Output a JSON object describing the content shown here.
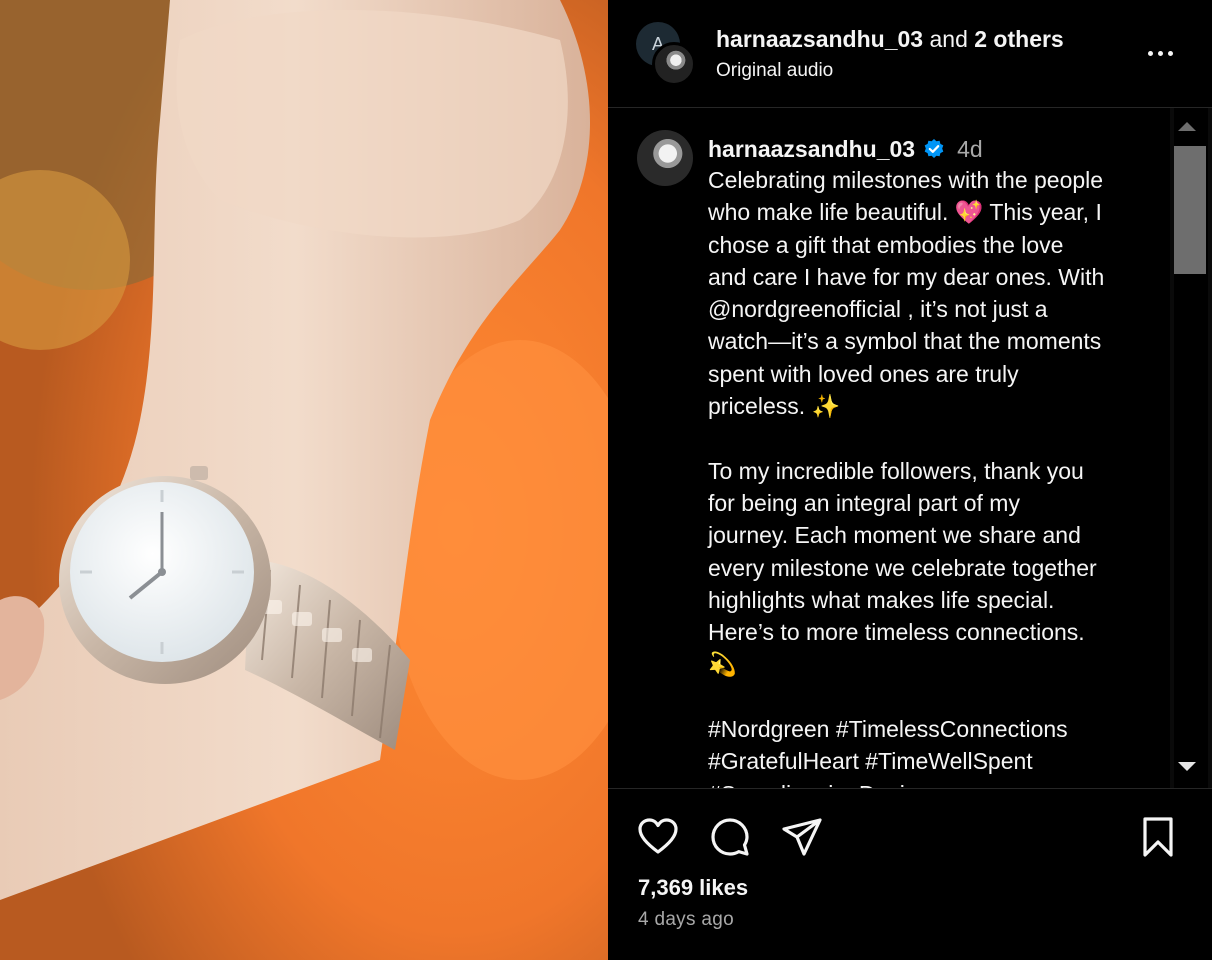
{
  "header": {
    "username": "harnaazsandhu_03",
    "and_text": " and ",
    "others": "2 others",
    "audio": "Original audio",
    "avatar_letter": "A"
  },
  "post": {
    "username": "harnaazsandhu_03",
    "time": "4d",
    "caption": "Celebrating milestones with the people\nwho make life beautiful. 💖 This year, I\nchose a gift that embodies the love\nand care I have for my dear ones. With\n@nordgreenofficial , it’s not just a\nwatch—it’s a symbol that the moments\nspent with loved ones are truly\npriceless. ✨\n\nTo my incredible followers, thank you\nfor being an integral part of my\njourney. Each moment we share and\nevery milestone we celebrate together\nhighlights what makes life special.\nHere’s to more timeless connections.\n💫\n\n#Nordgreen #TimelessConnections\n#GratefulHeart #TimeWellSpent\n#ScandinavianDesign"
  },
  "footer": {
    "likes": "7,369 likes",
    "posted": "4 days ago"
  },
  "icons": {
    "like": "heart-icon",
    "comment": "comment-icon",
    "share": "share-icon",
    "save": "bookmark-icon",
    "more": "more-icon",
    "verified": "verified-badge-icon"
  },
  "colors": {
    "background": "#000000",
    "text": "#f5f5f5",
    "muted": "#a8a8a8",
    "verified": "#0095f6",
    "divider": "#262626"
  }
}
